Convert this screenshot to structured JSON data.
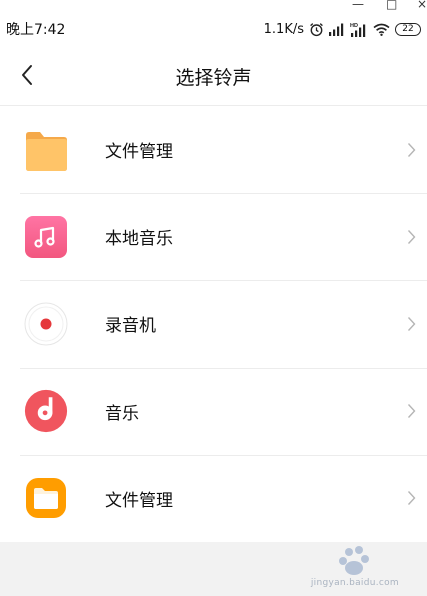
{
  "window": {
    "minimize": "—",
    "maximize": "□",
    "close": "×"
  },
  "status_bar": {
    "time": "晚上7:42",
    "net_speed": "1.1K/s",
    "battery": "22",
    "icons": [
      "alarm-icon",
      "signal-icon",
      "hd-signal-icon",
      "wifi-icon",
      "battery-icon"
    ]
  },
  "header": {
    "title": "选择铃声",
    "back_icon": "chevron-left-icon"
  },
  "list": {
    "items": [
      {
        "label": "文件管理",
        "icon": "folder-icon"
      },
      {
        "label": "本地音乐",
        "icon": "music-note-icon"
      },
      {
        "label": "录音机",
        "icon": "recorder-icon"
      },
      {
        "label": "音乐",
        "icon": "music-disc-icon"
      },
      {
        "label": "文件管理",
        "icon": "file-manager-icon"
      }
    ]
  },
  "watermark": {
    "text": "jingyan.baidu.com"
  },
  "colors": {
    "folder": "#ffbe5c",
    "music_pink": "#f7658f",
    "record_red": "#e5383b",
    "music_red": "#f0555e",
    "file_orange": "#ff9d00"
  }
}
